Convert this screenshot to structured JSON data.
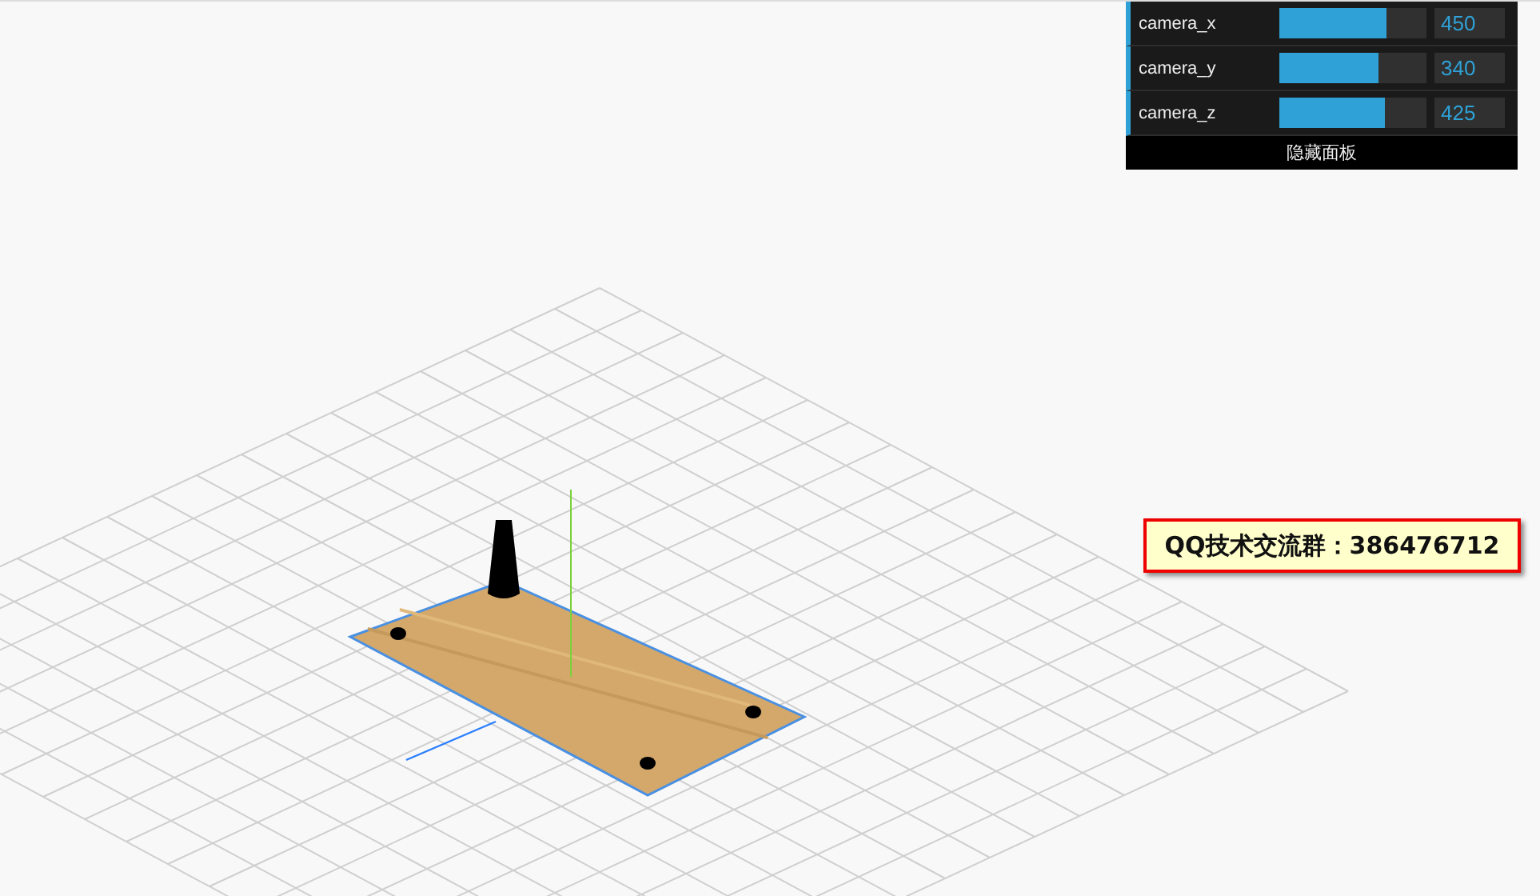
{
  "gui_panel": {
    "controls": [
      {
        "label": "camera_x",
        "level": 0.73,
        "value": "450"
      },
      {
        "label": "camera_y",
        "level": 0.67,
        "value": "340"
      },
      {
        "label": "camera_z",
        "level": 0.72,
        "value": "425"
      }
    ],
    "close_button": "隐藏面板"
  },
  "info_box": {
    "text": "QQ技术交流群：386476712"
  }
}
